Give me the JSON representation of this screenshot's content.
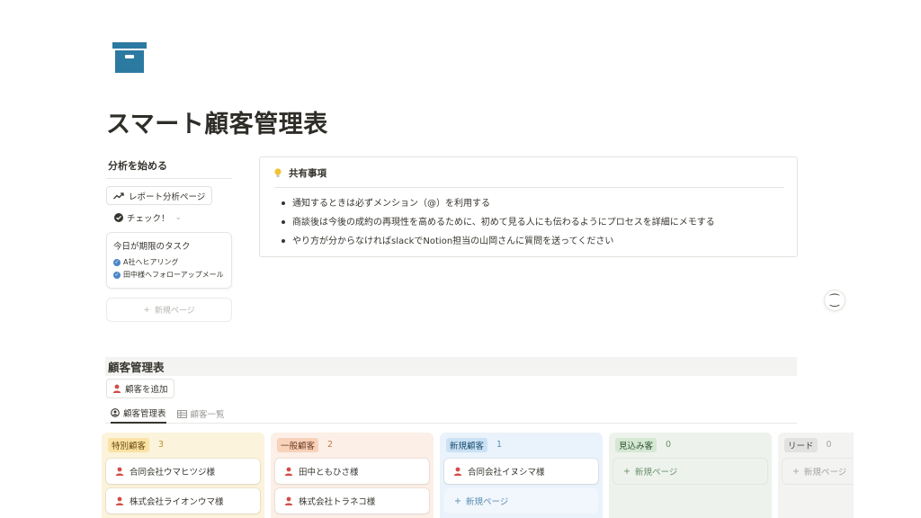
{
  "page": {
    "title": "スマート顧客管理表",
    "icon": "archive-box-icon",
    "accent": "#2c7aa1"
  },
  "left": {
    "heading": "分析を始める",
    "report_button": "レポート分析ページ",
    "check_label": "チェック！",
    "task_card": {
      "title": "今日が期限のタスク",
      "items": [
        "A社へヒアリング",
        "田中様へフォローアップメール"
      ]
    },
    "new_page": "新規ページ"
  },
  "callout": {
    "title": "共有事項",
    "items": [
      "通知するときは必ずメンション（@）を利用する",
      "商談後は今後の成約の再現性を高めるために、初めて見る人にも伝わるようにプロセスを詳細にメモする",
      "やり方が分からなければslackでNotion担当の山岡さんに質問を送ってください"
    ]
  },
  "side_icon": "⁐",
  "database": {
    "title": "顧客管理表",
    "add_button": "顧客を追加",
    "tabs": [
      {
        "label": "顧客管理表",
        "icon": "board-icon"
      },
      {
        "label": "顧客一覧",
        "icon": "table-icon"
      }
    ],
    "columns": [
      {
        "tag": "特別顧客",
        "count": "3",
        "bg": "#fbf3db",
        "tag_bg": "#fbe2a5",
        "tag_color": "#6b4a0e",
        "count_color": "#c29233",
        "cards": [
          "合同会社ウマヒツジ様",
          "株式会社ライオンウマ様"
        ],
        "new_page": ""
      },
      {
        "tag": "一般顧客",
        "count": "2",
        "bg": "#fcefe7",
        "tag_bg": "#f8d2bb",
        "tag_color": "#6e3b1f",
        "count_color": "#c7784a",
        "cards": [
          "田中ともひさ様",
          "株式会社トラネコ様"
        ],
        "new_page": ""
      },
      {
        "tag": "新規顧客",
        "count": "1",
        "bg": "#eaf3fb",
        "tag_bg": "#cbe2f5",
        "tag_color": "#1e4f72",
        "count_color": "#5b8db5",
        "cards": [
          "合同会社イヌシマ様"
        ],
        "new_page": "新規ページ"
      },
      {
        "tag": "見込み客",
        "count": "0",
        "bg": "#edf3ec",
        "tag_bg": "#d5e8d4",
        "tag_color": "#2f5130",
        "count_color": "#6d8f6c",
        "cards": [],
        "new_page": "新規ページ"
      },
      {
        "tag": "リード",
        "count": "0",
        "bg": "#f3f3f2",
        "tag_bg": "#e2e2e0",
        "tag_color": "#4a4946",
        "count_color": "#a6a5a1",
        "cards": [],
        "new_page": "新規ページ"
      }
    ]
  }
}
